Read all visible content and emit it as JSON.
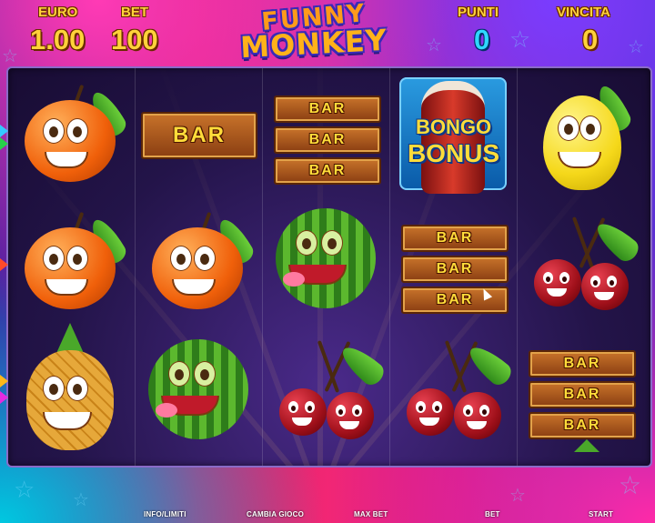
{
  "hud": {
    "euro_label": "EURO",
    "euro_value": "1.00",
    "bet_label": "BET",
    "bet_value": "100",
    "punti_label": "PUNTI",
    "punti_value": "0",
    "vincita_label": "VINCITA",
    "vincita_value": "0"
  },
  "logo": {
    "line1": "FUNNY",
    "line2": "MONKEY"
  },
  "reels": [
    [
      "orange",
      "orange",
      "pineapple"
    ],
    [
      "bar",
      "orange",
      "watermelon"
    ],
    [
      "triple-bar",
      "watermelon",
      "cherries"
    ],
    [
      "bongo-bonus",
      "triple-bar",
      "cherries"
    ],
    [
      "lemon",
      "cherries",
      "triple-bar"
    ]
  ],
  "symbols": {
    "bar_text": "BAR",
    "bongo_line1": "BONGO",
    "bongo_line2": "BONUS"
  },
  "buttons": {
    "info": "INFO/LIMITI",
    "change_game": "CAMBIA GIOCO",
    "max_bet": "MAX BET",
    "bet": "BET",
    "start": "START"
  },
  "colors": {
    "gold_text": "#ffd23a",
    "blue_text": "#2fd8ff",
    "reel_bg": "#231449"
  }
}
